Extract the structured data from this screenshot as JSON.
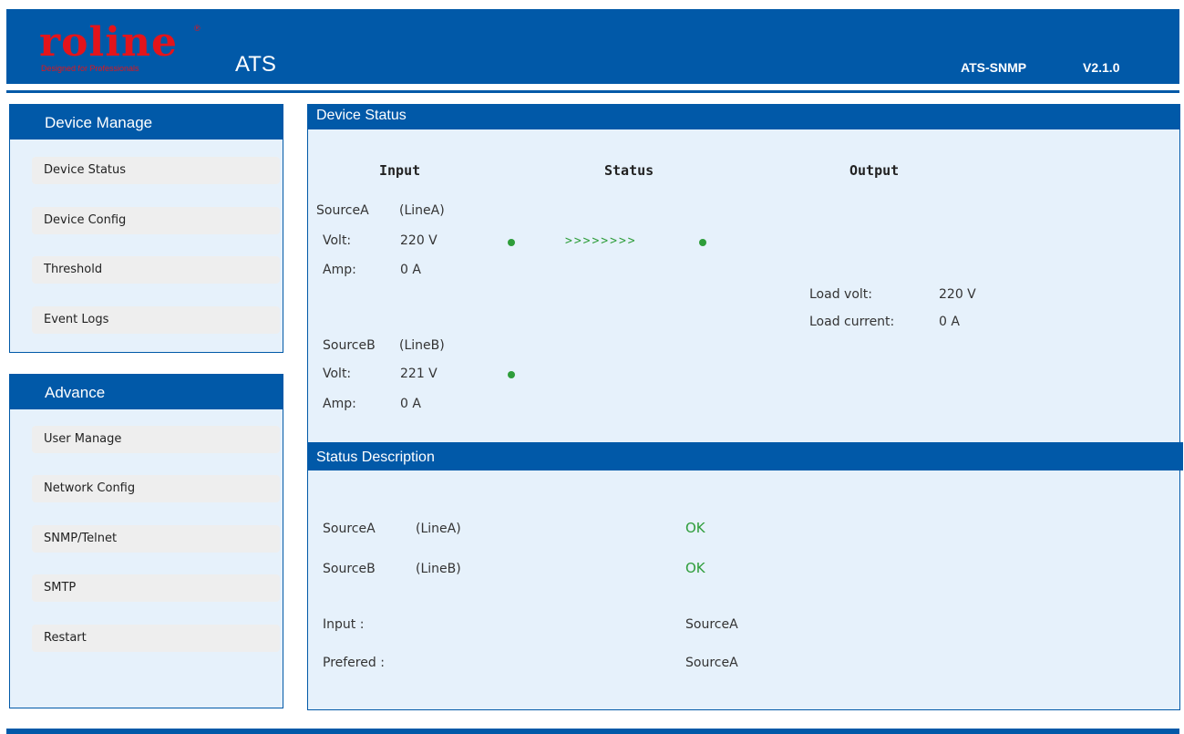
{
  "header": {
    "logo_text": "roline",
    "logo_reg": "®",
    "logo_tagline": "Designed for Professionals",
    "app_title": "ATS",
    "model": "ATS-SNMP",
    "version": "V2.1.0"
  },
  "sidebar": {
    "device_manage": {
      "title": "Device Manage",
      "items": [
        "Device Status",
        "Device Config",
        "Threshold",
        "Event Logs"
      ]
    },
    "advance": {
      "title": "Advance",
      "items": [
        "User Manage",
        "Network Config",
        "SNMP/Telnet",
        "SMTP",
        "Restart"
      ]
    }
  },
  "device_status": {
    "title": "Device Status",
    "columns": {
      "input": "Input",
      "status": "Status",
      "output": "Output"
    },
    "source_a": {
      "name": "SourceA",
      "line": "(LineA)",
      "volt_label": "Volt:",
      "volt": "220 V",
      "amp_label": "Amp:",
      "amp": "0 A",
      "indicator": "green"
    },
    "source_b": {
      "name": "SourceB",
      "line": "(LineB)",
      "volt_label": "Volt:",
      "volt": "221 V",
      "amp_label": "Amp:",
      "amp": "0 A",
      "indicator": "green"
    },
    "flow_arrows": ">>>>>>>>",
    "output": {
      "load_volt_label": "Load volt:",
      "load_volt": "220 V",
      "load_current_label": "Load current:",
      "load_current": "0 A"
    }
  },
  "status_description": {
    "title": "Status Description",
    "source_a": {
      "name": "SourceA",
      "line": "(LineA)",
      "status": "OK"
    },
    "source_b": {
      "name": "SourceB",
      "line": "(LineB)",
      "status": "OK"
    },
    "input": {
      "label": "Input :",
      "value": "SourceA"
    },
    "prefered": {
      "label": "Prefered :",
      "value": "SourceA"
    }
  },
  "colors": {
    "brand_blue": "#0159a8",
    "logo_red": "#e3141b",
    "panel_bg": "#e6f1fb",
    "status_green": "#2e9d3a"
  },
  "icons": {
    "status_dot": "status-dot-icon"
  }
}
